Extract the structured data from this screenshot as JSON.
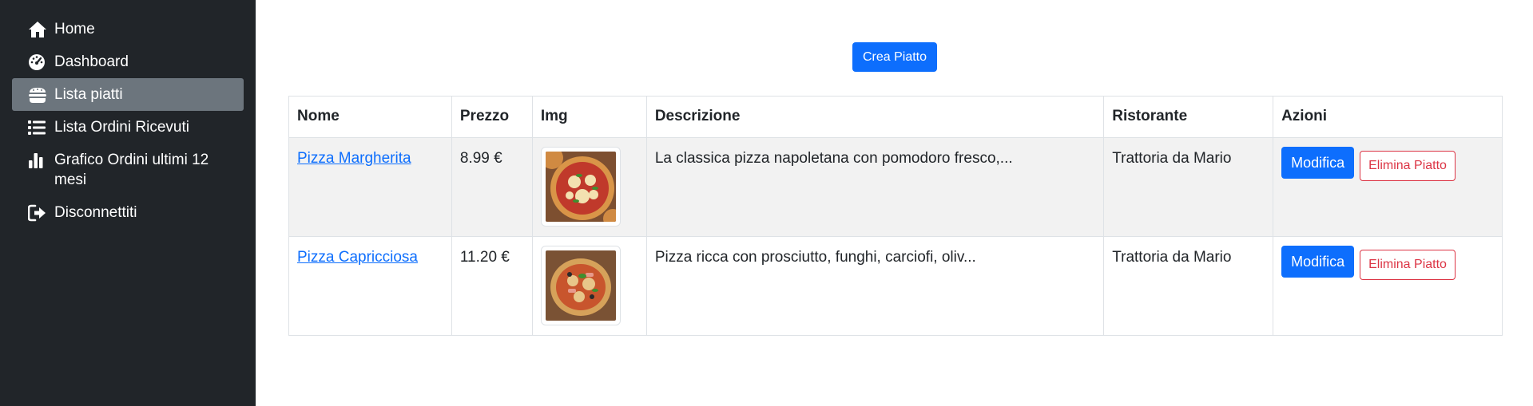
{
  "sidebar": {
    "items": [
      {
        "label": "Home",
        "icon": "home-icon"
      },
      {
        "label": "Dashboard",
        "icon": "speedometer-icon"
      },
      {
        "label": "Lista piatti",
        "icon": "dishes-icon",
        "active": true
      },
      {
        "label": "Lista Ordini Ricevuti",
        "icon": "list-icon"
      },
      {
        "label": "Grafico Ordini ultimi 12 mesi",
        "icon": "bar-chart-icon"
      },
      {
        "label": "Disconnettiti",
        "icon": "logout-icon"
      }
    ]
  },
  "main": {
    "create_button_label": "Crea Piatto",
    "table": {
      "headers": [
        "Nome",
        "Prezzo",
        "Img",
        "Descrizione",
        "Ristorante",
        "Azioni"
      ],
      "rows": [
        {
          "name": "Pizza Margherita",
          "price": "8.99 €",
          "image": "pizza-margherita-image",
          "description": "La classica pizza napoletana con pomodoro fresco,...",
          "restaurant": "Trattoria da Mario",
          "edit_label": "Modifica",
          "delete_label": "Elimina Piatto"
        },
        {
          "name": "Pizza Capricciosa",
          "price": "11.20 €",
          "image": "pizza-capricciosa-image",
          "description": "Pizza ricca con prosciutto, funghi, carciofi, oliv...",
          "restaurant": "Trattoria da Mario",
          "edit_label": "Modifica",
          "delete_label": "Elimina Piatto"
        }
      ]
    }
  },
  "colors": {
    "sidebar_bg": "#212529",
    "active_item_bg": "#6c757d",
    "primary": "#0d6efd",
    "danger": "#dc3545",
    "stripe": "#f2f2f2"
  }
}
